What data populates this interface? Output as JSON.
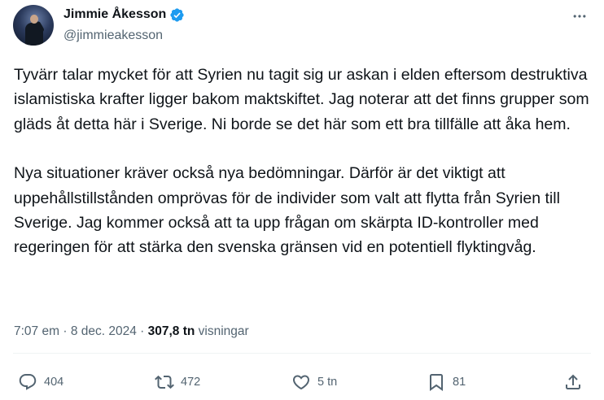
{
  "author": {
    "name": "Jimmie Åkesson",
    "handle": "@jimmieakesson"
  },
  "tweet": {
    "paragraphs": [
      "Tyvärr talar mycket för att Syrien nu tagit sig ur askan i elden eftersom destruktiva islamistiska krafter ligger bakom maktskiftet. Jag noterar att det finns grupper som gläds åt detta här i Sverige. Ni borde se det här som ett bra tillfälle att åka hem.",
      "Nya situationer kräver också nya bedömningar. Därför är det viktigt att uppehållstillstånden omprövas för de individer som valt att flytta från Syrien till Sverige. Jag kommer också att ta upp frågan om skärpta ID-kontroller med regeringen för att stärka den svenska gränsen vid en potentiell flyktingvåg."
    ]
  },
  "meta": {
    "time": "7:07 em",
    "separator": "·",
    "date": "8 dec. 2024",
    "views_count": "307,8 tn",
    "views_label": "visningar"
  },
  "actions": {
    "replies": "404",
    "reposts": "472",
    "likes": "5 tn",
    "bookmarks": "81"
  },
  "icons": {
    "verified": "verified-badge-icon",
    "more": "more-horizontal-icon",
    "reply": "reply-icon",
    "repost": "repost-icon",
    "like": "heart-icon",
    "bookmark": "bookmark-icon",
    "share": "share-icon"
  },
  "colors": {
    "verified": "#1d9bf0",
    "text": "#0f1419",
    "secondary": "#536471",
    "divider": "#eff3f4"
  }
}
